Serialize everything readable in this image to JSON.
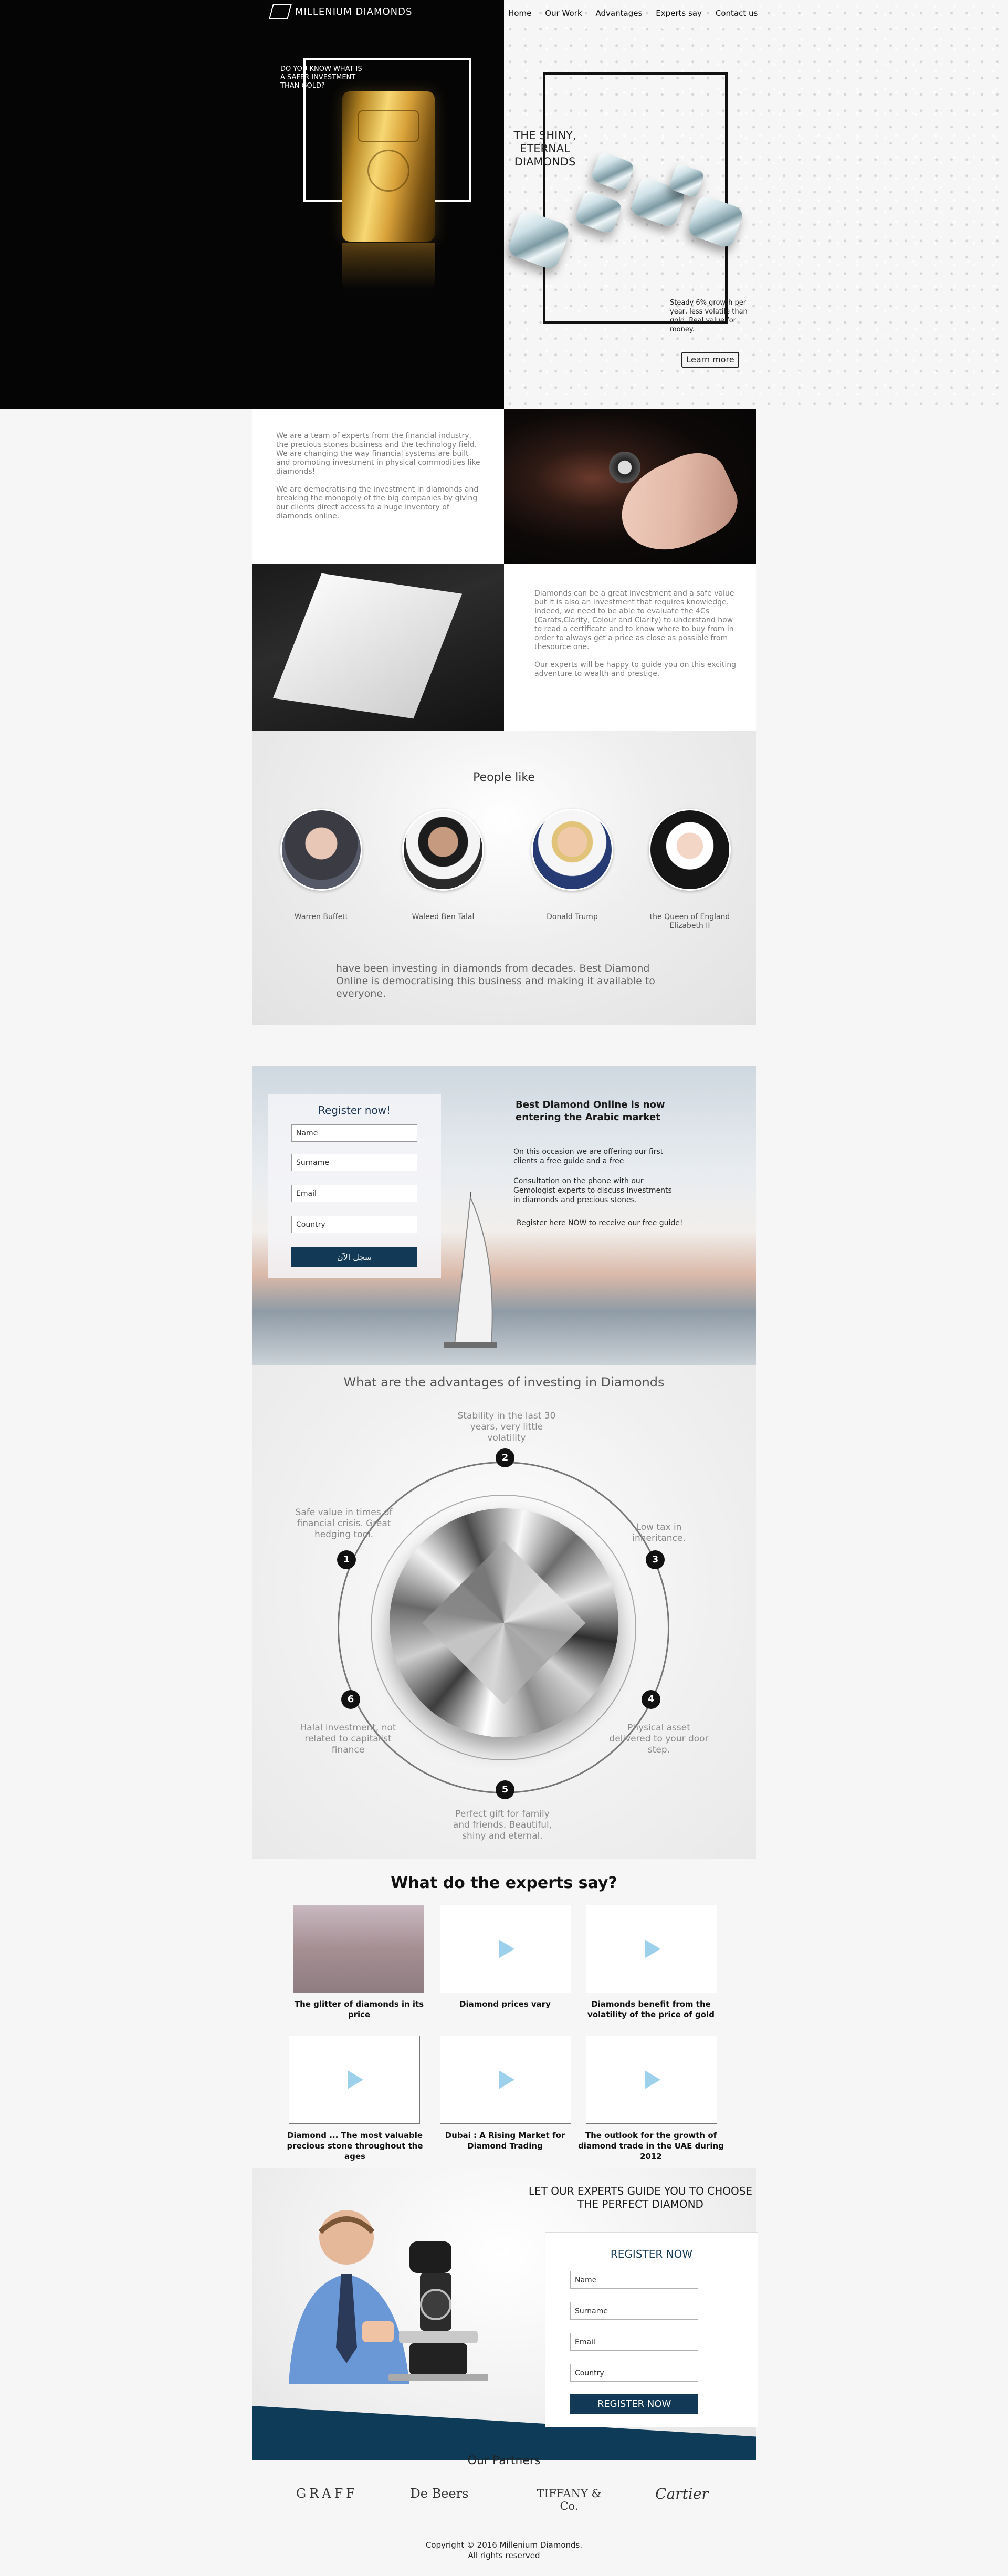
{
  "brand": {
    "name": "MILLENIUM DIAMONDS"
  },
  "nav": [
    "Home",
    "Our Work",
    "Advantages",
    "Experts say",
    "Contact us"
  ],
  "hero": {
    "gold_question": "DO YOU KNOW WHAT IS A SAFER INVESTMENT THAN GOLD?",
    "diamond_title": "THE SHINY, ETERNAL DIAMONDS",
    "diamond_note": "Steady 6% growth per year, less volatile than gold. Real value for money.",
    "learn_more": "Learn more"
  },
  "about": {
    "p1": "We are a team of experts from the financial industry, the precious stones business and the technology field. We are changing the way financial systems are built and promoting investment in physical commodities like diamonds!",
    "p2": "We are democratising the investment in diamonds and breaking the monopoly of the big companies by giving our clients direct access to a huge inventory of diamonds online.",
    "p3": "Diamonds can be a great investment and a safe value but it is also an investment that requires knowledge. Indeed, we need to be able to evaluate the 4Cs (Carats,Clarity, Colour and Clarity) to understand how to read a certificate and to know where to buy from in order to always get a price as close as possible from thesource one.",
    "p4": "Our experts will be happy to guide you on this exciting adventure to wealth and prestige."
  },
  "people": {
    "title": "People like",
    "items": [
      {
        "name": "Warren Buffett"
      },
      {
        "name": "Waleed Ben Talal"
      },
      {
        "name": "Donald Trump"
      },
      {
        "name": "the Queen of England Elizabeth II"
      }
    ],
    "quote": "have been investing in diamonds from decades. Best Diamond Online is democratising this business and making it available to everyone."
  },
  "arabic": {
    "register_title": "Register now!",
    "fields": [
      "Name",
      "Surname",
      "Email",
      "Country"
    ],
    "button": "سجل الآن",
    "title": "Best Diamond Online is now entering the Arabic market",
    "p1": "On this occasion we are offering our first clients a free guide and a free",
    "p2": "Consultation on the phone with our Gemologist experts to discuss investments in diamonds and precious stones.",
    "p3": "Register here NOW to receive our free guide!"
  },
  "advantages": {
    "title": "What are the advantages of investing in Diamonds",
    "items": [
      {
        "num": "1",
        "text": "Safe value in times of financial crisis. Great hedging tool."
      },
      {
        "num": "2",
        "text": "Stability in the last 30 years, very little volatility"
      },
      {
        "num": "3",
        "text": "Low tax in inheritance."
      },
      {
        "num": "4",
        "text": "Physical asset delivered to your door step."
      },
      {
        "num": "5",
        "text": "Perfect gift for family and friends. Beautiful, shiny and eternal."
      },
      {
        "num": "6",
        "text": "Halal investment, not related to capitalist finance"
      }
    ]
  },
  "experts": {
    "title": "What do the experts say?",
    "videos": [
      "The glitter of diamonds in its price",
      "Diamond prices vary",
      "Diamonds benefit from the volatility of the price of gold",
      "Diamond ... The most valuable precious stone throughout the ages",
      "Dubai : A Rising Market for Diamond Trading",
      "The outlook for the growth of diamond trade in the UAE during 2012"
    ]
  },
  "guide": {
    "title": "LET OUR EXPERTS GUIDE YOU TO CHOOSE THE PERFECT DIAMOND",
    "form_title": "REGISTER NOW",
    "fields": [
      "Name",
      "Surname",
      "Email",
      "Country"
    ],
    "button": "REGISTER NOW"
  },
  "partners": {
    "title": "Our Partners",
    "items": [
      "GRAFF",
      "De Beers",
      "TIFFANY & Co.",
      "Cartier"
    ]
  },
  "footer": {
    "copyright": "Copyright © 2016 Millenium Diamonds.",
    "rights": "All rights reserved"
  }
}
